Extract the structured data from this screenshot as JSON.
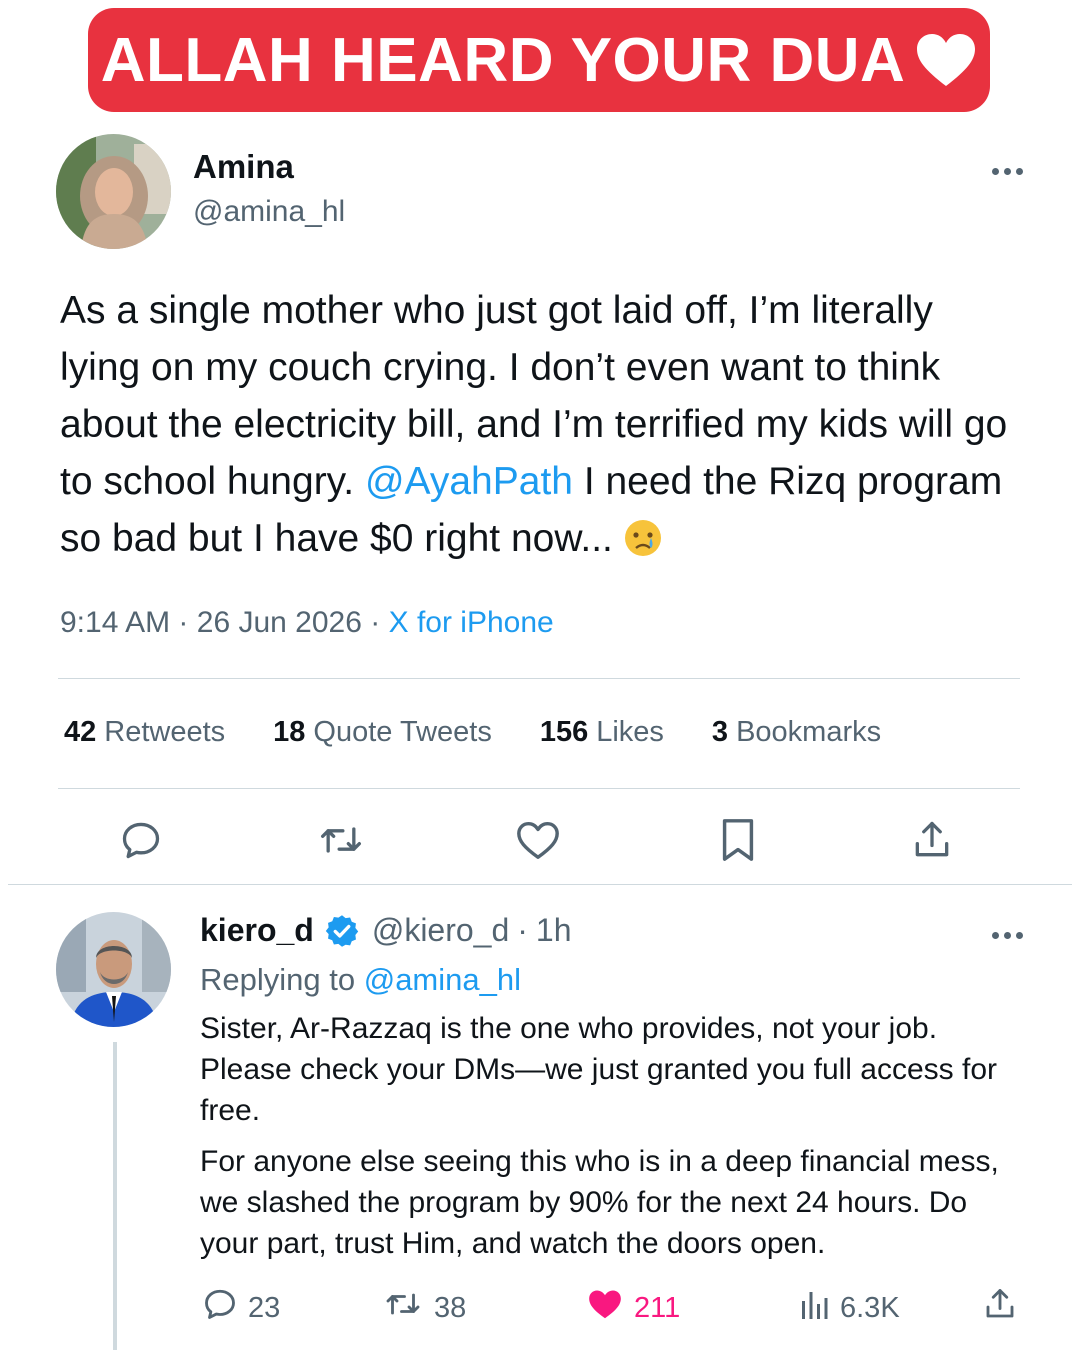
{
  "banner": {
    "text": "ALLAH HEARD YOUR DUA",
    "heart_icon": "white-heart-icon"
  },
  "tweet": {
    "author_name": "Amina",
    "author_handle": "@amina_hl",
    "text_part1": "As a single mother who just got laid off, I’m literally lying on my couch crying. I don’t even want to think about the electricity bill, and I’m terrified my kids will go to school hungry. ",
    "mention": "@AyahPath",
    "text_part2": " I need the Rizq program so bad but I have $0 right now...",
    "emoji_icon": "crying-face-icon",
    "time": "9:14 AM",
    "date": "26 Jun 2026",
    "separator": "·",
    "source": "X for iPhone",
    "stats": [
      {
        "count": "42",
        "label": "Retweets"
      },
      {
        "count": "18",
        "label": "Quote Tweets"
      },
      {
        "count": "156",
        "label": "Likes"
      },
      {
        "count": "3",
        "label": "Bookmarks"
      }
    ],
    "actions": [
      "reply-icon",
      "retweet-icon",
      "like-icon",
      "bookmark-icon",
      "share-icon"
    ]
  },
  "reply": {
    "author_name": "kiero_d",
    "author_handle": "@kiero_d",
    "separator": "·",
    "time": "1h",
    "replying_prefix": "Replying to",
    "replying_to": "@amina_hl",
    "paragraph1": "Sister, Ar-Razzaq is the one who provides, not your job. Please check your DMs—we just granted you full access for free.",
    "paragraph2": "For anyone else seeing this who is in a deep financial mess, we slashed the program by 90% for the next 24 hours. Do your part, trust Him, and watch the doors open.",
    "replies": "23",
    "retweets": "38",
    "likes": "211",
    "views": "6.3K"
  },
  "colors": {
    "banner": "#e8323f",
    "link": "#1d9bf0",
    "like": "#f91880",
    "secondary_text": "#536471",
    "divider": "#cfd9de"
  }
}
